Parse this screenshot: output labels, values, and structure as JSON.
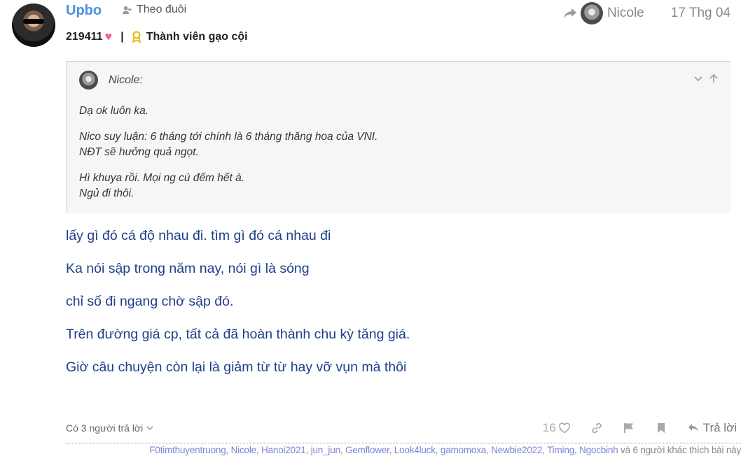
{
  "author": {
    "name": "Upbo",
    "follow_label": "Theo đuôi",
    "score": "219411",
    "separator": "|",
    "badge": "Thành viên gạo cội"
  },
  "header": {
    "replied_to": "Nicole",
    "date": "17 Thg 04"
  },
  "quote": {
    "author": "Nicole:",
    "lines": [
      "Dạ ok luôn ka.",
      "Nico suy luận: 6 tháng tới chính là 6 tháng thăng hoa của VNI.",
      "NĐT sẽ hưởng quả ngọt.",
      "Hì khuya rồi. Mọi ng cú đếm hết à.",
      "Ngủ đi thôi."
    ]
  },
  "post": {
    "paragraphs": [
      "lấy gì đó cá độ nhau đi. tìm gì đó cá nhau đi",
      "Ka nói sập trong năm nay, nói gì là sóng",
      "chỉ số đi ngang chờ sập đó.",
      "Trên đường giá cp, tất cả đã hoàn thành chu kỳ tăng giá.",
      "Giờ câu chuyện còn lại là giảm từ từ hay vỡ vụn mà thôi"
    ]
  },
  "footer": {
    "replies_label": "Có 3 người trả lời",
    "like_count": "16",
    "reply_label": "Trả lời"
  },
  "likers": {
    "names": [
      "F0timthuyentruong",
      "Nicole",
      "Hanoi2021",
      "jun_jun",
      "Gemflower",
      "Look4luck",
      "gamomoxa",
      "Newbie2022",
      "Timing",
      "Ngocbinh"
    ],
    "separator": ", ",
    "suffix": " và 6 người khác thích bài này"
  },
  "colors": {
    "username": "#4a90e2",
    "post_text": "#1d3f8a",
    "heart": "#f06292",
    "badge": "#e6b800",
    "liker_link": "#7b83d6"
  },
  "icons": [
    "follow-icon",
    "heart-icon",
    "badge-icon",
    "share-icon",
    "chevron-down-icon",
    "arrow-up-icon",
    "like-icon",
    "link-icon",
    "flag-icon",
    "bookmark-icon",
    "reply-icon"
  ]
}
